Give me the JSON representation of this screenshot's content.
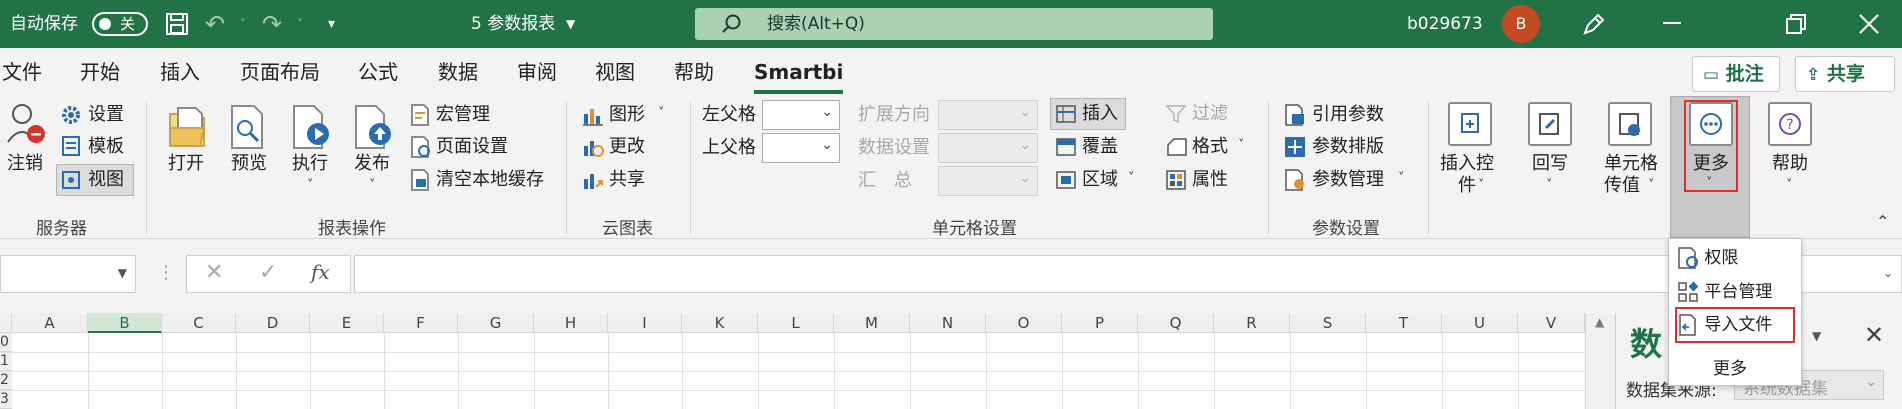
{
  "titlebar": {
    "autosave_label": "自动保存",
    "autosave_state": "关",
    "doc_title": "5 参数报表",
    "search_placeholder": "搜索(Alt+Q)",
    "user": "b029673",
    "avatar_initial": "B"
  },
  "menu": {
    "tabs": [
      "文件",
      "开始",
      "插入",
      "页面布局",
      "公式",
      "数据",
      "审阅",
      "视图",
      "帮助",
      "Smartbi"
    ],
    "active_tab": "Smartbi",
    "comment_btn": "批注",
    "share_btn": "共享"
  },
  "ribbon": {
    "server": {
      "logout": "注销",
      "settings": "设置",
      "template": "模板",
      "view": "视图",
      "group": "服务器"
    },
    "report": {
      "open": "打开",
      "preview": "预览",
      "run": "执行",
      "publish": "发布",
      "macro": "宏管理",
      "page_setup": "页面设置",
      "clear_cache": "清空本地缓存",
      "group": "报表操作"
    },
    "cloud": {
      "chart": "图形",
      "change": "更改",
      "share": "共享",
      "group": "云图表"
    },
    "cell": {
      "left_parent": "左父格",
      "top_parent": "上父格",
      "expand_dir": "扩展方向",
      "data_settings": "数据设置",
      "summary": "汇　总",
      "insert": "插入",
      "cover": "覆盖",
      "region": "区域",
      "filter": "过滤",
      "format": "格式",
      "property": "属性",
      "group": "单元格设置"
    },
    "param": {
      "ref_param": "引用参数",
      "param_layout": "参数排版",
      "param_manage": "参数管理",
      "group": "参数设置"
    },
    "tools": {
      "insert_control_1": "插入控",
      "insert_control_2": "件",
      "writeback": "回写",
      "cell_pass_1": "单元格",
      "cell_pass_2": "传值",
      "more": "更多",
      "help": "帮助"
    }
  },
  "dropdown": {
    "items": [
      "权限",
      "平台管理",
      "导入文件"
    ],
    "footer": "更多"
  },
  "formula": {
    "fx": "fx"
  },
  "grid": {
    "columns": [
      "A",
      "B",
      "C",
      "D",
      "E",
      "F",
      "G",
      "H",
      "I",
      "K",
      "L",
      "M",
      "N",
      "O",
      "P",
      "Q",
      "R",
      "S",
      "T",
      "U",
      "V"
    ],
    "selected_column": "B",
    "rows": [
      "0",
      "1",
      "2",
      "3"
    ]
  },
  "sidepanel": {
    "title": "数",
    "source_label": "数据集来源:",
    "source_value": "系统数据集"
  },
  "colors": {
    "brand": "#217346",
    "highlight": "#d9312c"
  }
}
